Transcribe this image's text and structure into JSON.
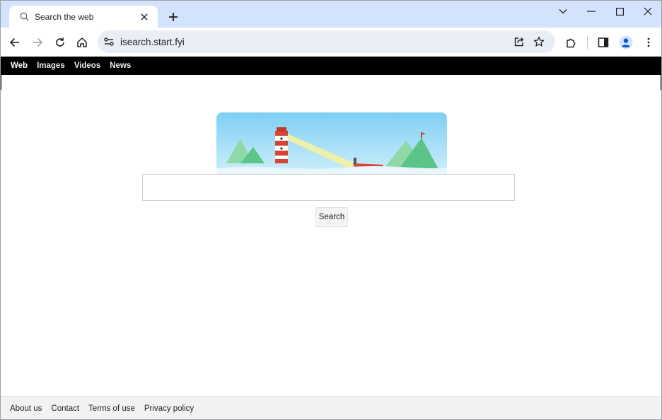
{
  "browser": {
    "tab": {
      "title": "Search the web",
      "icon": "search-icon"
    },
    "new_tab_icon": "plus-icon",
    "window_controls": [
      "chevron-down-icon",
      "minimize-icon",
      "maximize-icon",
      "close-icon"
    ],
    "address_bar": {
      "url": "isearch.start.fyi"
    },
    "toolbar_icons": [
      "back-arrow-icon",
      "forward-arrow-icon",
      "reload-icon",
      "home-icon",
      "share-icon",
      "star-icon",
      "extensions-icon",
      "side-panel-icon",
      "profile-icon",
      "more-menu-icon"
    ],
    "accent_color": "#d3e3fd"
  },
  "page": {
    "nav": {
      "items": [
        {
          "label": "Web",
          "active": true
        },
        {
          "label": "Images",
          "active": false
        },
        {
          "label": "Videos",
          "active": false
        },
        {
          "label": "News",
          "active": false
        }
      ]
    },
    "search": {
      "input_value": "",
      "button_label": "Search"
    },
    "footer": {
      "links": [
        "About us",
        "Contact",
        "Terms of use",
        "Privacy policy"
      ]
    }
  }
}
